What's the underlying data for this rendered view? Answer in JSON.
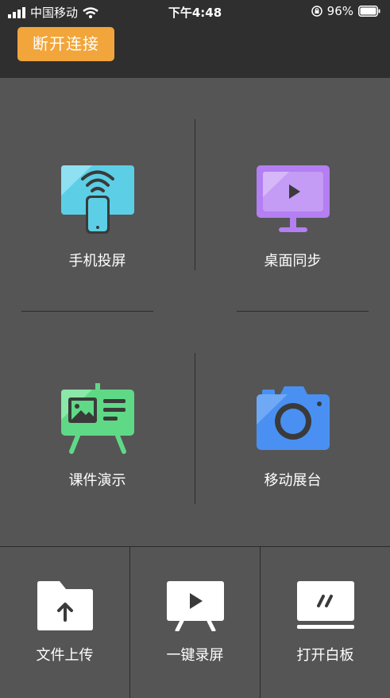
{
  "status_bar": {
    "carrier": "中国移动",
    "time": "下午4:48",
    "battery": "96%"
  },
  "topbar": {
    "disconnect_label": "断开连接",
    "accent": "#f1a53a"
  },
  "features": [
    {
      "label": "手机投屏",
      "icon": "phone-cast-icon",
      "color": "#5ccfe6"
    },
    {
      "label": "桌面同步",
      "icon": "desktop-sync-icon",
      "color": "#b37ff2"
    },
    {
      "label": "课件演示",
      "icon": "presentation-icon",
      "color": "#5fd986"
    },
    {
      "label": "移动展台",
      "icon": "camera-icon",
      "color": "#4a90f2"
    }
  ],
  "bottom": [
    {
      "label": "文件上传",
      "icon": "folder-upload-icon"
    },
    {
      "label": "一键录屏",
      "icon": "record-screen-icon"
    },
    {
      "label": "打开白板",
      "icon": "whiteboard-icon"
    }
  ]
}
